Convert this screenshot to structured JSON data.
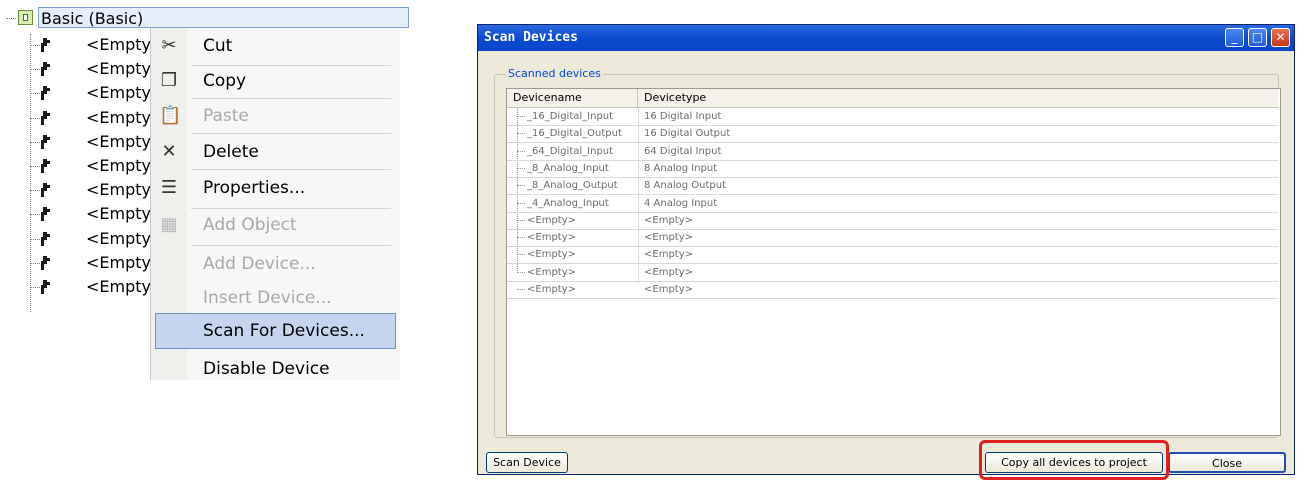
{
  "tree": {
    "root_label": "Basic (Basic)",
    "children": [
      "<Empty>",
      "<Empty>",
      "<Empty>",
      "<Empty>",
      "<Empty>",
      "<Empty>",
      "<Empty>",
      "<Empty>",
      "<Empty>",
      "<Empty>",
      "<Empty>"
    ]
  },
  "context_menu": {
    "items": [
      {
        "label": "Cut",
        "icon": "scissors-icon",
        "enabled": true
      },
      {
        "label": "Copy",
        "icon": "copy-icon",
        "enabled": true
      },
      {
        "label": "Paste",
        "icon": "paste-icon",
        "enabled": false
      },
      {
        "label": "Delete",
        "icon": "delete-x-icon",
        "enabled": true
      },
      {
        "label": "Properties...",
        "icon": "properties-icon",
        "enabled": true
      },
      {
        "label": "Add Object",
        "icon": "add-object-icon",
        "enabled": false
      },
      {
        "label": "Add Device...",
        "icon": "",
        "enabled": false
      },
      {
        "label": "Insert Device...",
        "icon": "",
        "enabled": false
      },
      {
        "label": "Scan For Devices...",
        "icon": "",
        "enabled": true,
        "highlighted": true
      },
      {
        "label": "Disable Device",
        "icon": "",
        "enabled": true
      }
    ]
  },
  "dialog": {
    "title": "Scan Devices",
    "group_label": "Scanned devices",
    "columns": [
      "Devicename",
      "Devicetype"
    ],
    "rows": [
      [
        "_16_Digital_Input",
        "16 Digital Input"
      ],
      [
        "_16_Digital_Output",
        "16 Digital Output"
      ],
      [
        "_64_Digital_Input",
        "64 Digital Input"
      ],
      [
        "_8_Analog_Input",
        "8 Analog Input"
      ],
      [
        "_8_Analog_Output",
        "8 Analog Output"
      ],
      [
        "_4_Analog_Input",
        "4 Analog Input"
      ],
      [
        "<Empty>",
        "<Empty>"
      ],
      [
        "<Empty>",
        "<Empty>"
      ],
      [
        "<Empty>",
        "<Empty>"
      ],
      [
        "<Empty>",
        "<Empty>"
      ],
      [
        "<Empty>",
        "<Empty>"
      ]
    ],
    "buttons": {
      "scan": "Scan Device",
      "copy_all": "Copy all devices to project",
      "close": "Close"
    },
    "title_buttons": {
      "minimize": "_",
      "maximize": "□",
      "close": "✕"
    }
  },
  "colors": {
    "highlight": "#e02020",
    "menu_highlight": "#c5d5f0",
    "titlebar": "#0a4ad0"
  }
}
